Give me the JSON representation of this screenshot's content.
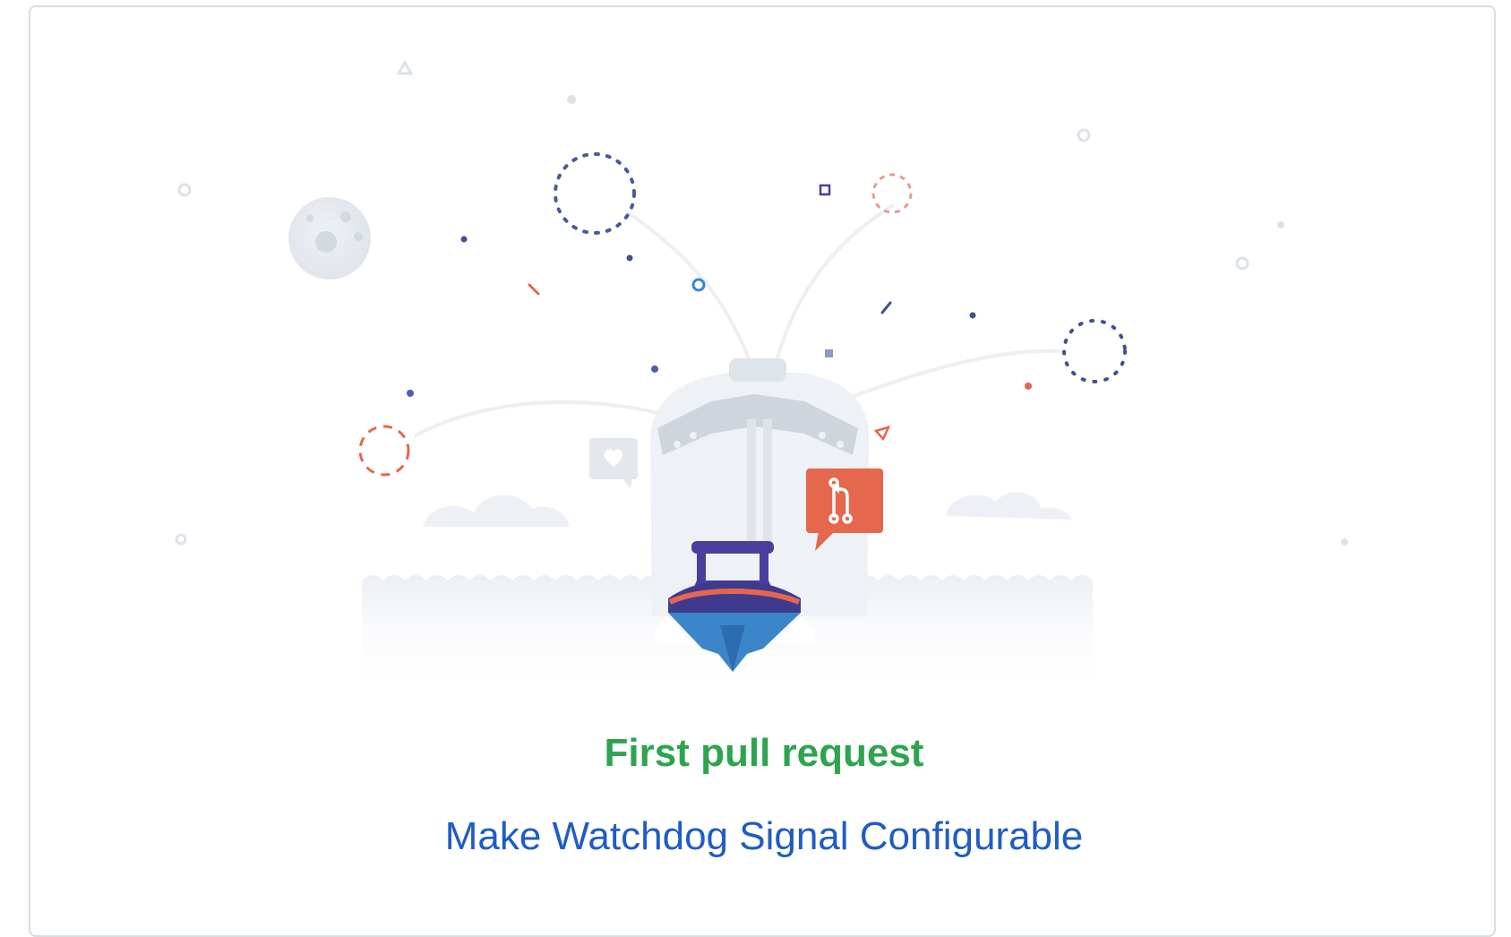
{
  "achievement": {
    "title": "First pull request",
    "pull_request_title": "Make Watchdog Signal Configurable"
  },
  "colors": {
    "title_green": "#2ea44f",
    "link_blue": "#1f5cc5",
    "accent_red": "#e5674d",
    "boat_purple": "#4a3f9e",
    "boat_blue": "#3b86c9",
    "card_border": "#d9dde2"
  },
  "icons": {
    "badge": "git-pull-request-icon",
    "speech": "heart-speech-bubble-icon"
  }
}
